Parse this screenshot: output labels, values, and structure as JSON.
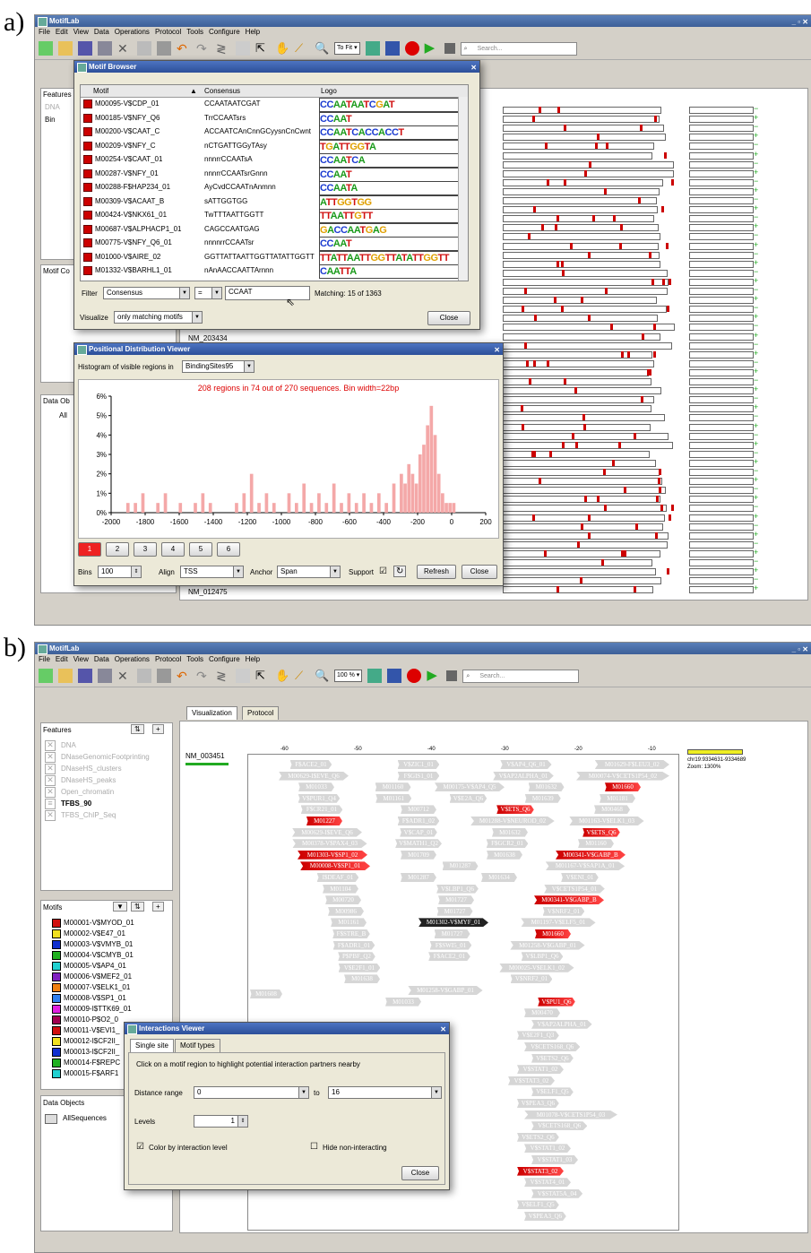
{
  "panel_a": {
    "letter": "a)",
    "app_title": "MotifLab",
    "menus": [
      "File",
      "Edit",
      "View",
      "Data",
      "Operations",
      "Protocol",
      "Tools",
      "Configure",
      "Help"
    ],
    "zoom": "To Fit",
    "search_placeholder": "Search...",
    "features_label": "Features",
    "features_items": [
      "DNA",
      "Bin"
    ],
    "motif_col_label": "Motif Co",
    "data_obj_label": "Data Ob",
    "data_obj_item": "All",
    "seq_labels": [
      "NM_203434",
      "NM_012475"
    ],
    "motif_browser": {
      "title": "Motif Browser",
      "columns": [
        "Motif",
        "Consensus",
        "Logo"
      ],
      "rows": [
        {
          "id": "M00095-V$CDP_01",
          "cons": "CCAATAATCGAT",
          "logo": "CCAATAATCGAT"
        },
        {
          "id": "M00185-V$NFY_Q6",
          "cons": "TrrCCAATsrs",
          "logo": "CCAAT"
        },
        {
          "id": "M00200-V$CAAT_C",
          "cons": "ACCAATCAnCnnGCyysnCnCwnt",
          "logo": "CCAATCACCACCT"
        },
        {
          "id": "M00209-V$NFY_C",
          "cons": "nCTGATTGGyTAsy",
          "logo": "TGATTGGTA"
        },
        {
          "id": "M00254-V$CAAT_01",
          "cons": "nnnrrCCAATsA",
          "logo": "CCAATCA"
        },
        {
          "id": "M00287-V$NFY_01",
          "cons": "nnnrrCCAATsrGnnn",
          "logo": "CCAAT"
        },
        {
          "id": "M00288-F$HAP234_01",
          "cons": "AyCvdCCAATnAnmnn",
          "logo": "CCAATA"
        },
        {
          "id": "M00309-V$ACAAT_B",
          "cons": "sATTGGTGG",
          "logo": "ATTGGTGG"
        },
        {
          "id": "M00424-V$NKX61_01",
          "cons": "TwTTTAATTGGTT",
          "logo": "TTAATTGTT"
        },
        {
          "id": "M00687-V$ALPHACP1_01",
          "cons": "CAGCCAATGAG",
          "logo": "GACCAATGAG"
        },
        {
          "id": "M00775-V$NFY_Q6_01",
          "cons": "nnnnrrCCAATsr",
          "logo": "CCAAT"
        },
        {
          "id": "M01000-V$AIRE_02",
          "cons": "GGTTATTAATTGGTTATATTGGTT",
          "logo": "TTATTAATTGGTTATATTGGTT"
        },
        {
          "id": "M01332-V$BARHL1_01",
          "cons": "nAnAACCAATTArnnn",
          "logo": "CAATTA"
        }
      ],
      "filter_label": "Filter",
      "filter_field": "Consensus",
      "filter_op": "=",
      "filter_value": "CCAAT",
      "matching": "Matching: 15 of 1363",
      "visualize_label": "Visualize",
      "visualize_value": "only matching motifs",
      "close": "Close"
    },
    "pdv": {
      "title": "Positional Distribution Viewer",
      "histogram_label": "Histogram of visible regions in",
      "histogram_track": "BindingSites95",
      "close": "Close",
      "refresh": "Refresh",
      "pages": [
        "1",
        "2",
        "3",
        "4",
        "5",
        "6"
      ],
      "bins_label": "Bins",
      "bins_value": "100",
      "align_label": "Align",
      "align_value": "TSS",
      "anchor_label": "Anchor",
      "anchor_value": "Span",
      "support_label": "Support"
    }
  },
  "chart_data": {
    "type": "bar",
    "title": "208 regions in 74 out of 270 sequences.  Bin width=22bp",
    "xlabel": "",
    "ylabel": "",
    "xlim": [
      -2000,
      200
    ],
    "ylim": [
      0,
      6
    ],
    "xticks": [
      -2000,
      -1800,
      -1600,
      -1400,
      -1200,
      -1000,
      -800,
      -600,
      -400,
      -200,
      0,
      200
    ],
    "yticks": [
      "0%",
      "1%",
      "2%",
      "3%",
      "4%",
      "5%",
      "6%"
    ],
    "bin_width": 22,
    "x": [
      -1900,
      -1856,
      -1812,
      -1724,
      -1680,
      -1592,
      -1504,
      -1460,
      -1416,
      -1262,
      -1218,
      -1174,
      -1130,
      -1086,
      -1042,
      -954,
      -910,
      -866,
      -822,
      -778,
      -734,
      -690,
      -646,
      -602,
      -558,
      -514,
      -470,
      -426,
      -382,
      -338,
      -294,
      -272,
      -250,
      -228,
      -206,
      -184,
      -162,
      -140,
      -118,
      -96,
      -74,
      -52,
      -30,
      -8,
      14
    ],
    "values": [
      0.5,
      0.5,
      1.0,
      0.5,
      1.0,
      0.5,
      0.5,
      1.0,
      0.5,
      0.5,
      1.0,
      2.0,
      0.5,
      1.0,
      0.5,
      1.0,
      0.5,
      1.5,
      0.5,
      1.0,
      0.5,
      1.5,
      0.5,
      1.0,
      0.5,
      1.0,
      0.5,
      1.0,
      0.5,
      1.5,
      2.0,
      1.5,
      2.5,
      2.0,
      1.5,
      3.0,
      3.5,
      4.5,
      5.5,
      4.0,
      2.0,
      1.0,
      0.5,
      0.5,
      0.5
    ]
  },
  "panel_b": {
    "letter": "b)",
    "app_title": "MotifLab",
    "menus": [
      "File",
      "Edit",
      "View",
      "Data",
      "Operations",
      "Protocol",
      "Tools",
      "Configure",
      "Help"
    ],
    "zoom": "100 %",
    "search_placeholder": "Search...",
    "tabs": [
      "Visualization",
      "Protocol"
    ],
    "features_label": "Features",
    "features": [
      "DNA",
      "DNaseGenomicFootprinting",
      "DNaseHS_clusters",
      "DNaseHS_peaks",
      "Open_chromatin",
      "TFBS_90",
      "TFBS_ChIP_Seq"
    ],
    "motifs_label": "Motifs",
    "motifs": [
      {
        "name": "M00001-V$MYOD_01",
        "color": "#d01010"
      },
      {
        "name": "M00002-V$E47_01",
        "color": "#f0e020"
      },
      {
        "name": "M00003-V$VMYB_01",
        "color": "#1030d0"
      },
      {
        "name": "M00004-V$CMYB_01",
        "color": "#20b020"
      },
      {
        "name": "M00005-V$AP4_01",
        "color": "#20d0d0"
      },
      {
        "name": "M00006-V$MEF2_01",
        "color": "#8020c0"
      },
      {
        "name": "M00007-V$ELK1_01",
        "color": "#f08010"
      },
      {
        "name": "M00008-V$SP1_01",
        "color": "#3080f0"
      },
      {
        "name": "M00009-I$TTK69_01",
        "color": "#e020e0"
      },
      {
        "name": "M00010-P$O2_0",
        "color": "#a00050"
      },
      {
        "name": "M00011-V$EVI1_",
        "color": "#d01010"
      },
      {
        "name": "M00012-I$CF2II_",
        "color": "#f0e020"
      },
      {
        "name": "M00013-I$CF2II_",
        "color": "#1030d0"
      },
      {
        "name": "M00014-F$REPC",
        "color": "#20b020"
      },
      {
        "name": "M00015-F$ARF1",
        "color": "#20d0d0"
      }
    ],
    "data_objects_label": "Data Objects",
    "data_objects_item": "AllSequences",
    "sequence_name": "NM_003451",
    "ruler": [
      "-60",
      "-50",
      "-40",
      "-30",
      "-20",
      "-10"
    ],
    "region_info": "chr19:9334631-9334689",
    "zoom_info": "Zoom: 1300%",
    "regions": [
      [
        "F$ACE2_01",
        "V$ZIC1_01",
        "V$AP4_Q6_01",
        "M01629-F$LEU3_02"
      ],
      [
        "M00629-I$EVE_Q6",
        "F$GIS1_01",
        "V$AP2ALPHA_01",
        "M00074-V$CETS1P54_02"
      ],
      [
        "M01033",
        "M01160",
        "M00175-V$AP4_Q5",
        "M01632",
        "M01660"
      ],
      [
        "V$PUR1_Q4",
        "M01161",
        "V$E2A_Q6",
        "M01639",
        "M01181"
      ],
      [
        "F$CR21_01",
        "M00712",
        "V$ETS_Q6",
        "M00468"
      ],
      [
        "M01227",
        "F$ADR1_02",
        "M01288-V$NEUROD_02",
        "M01163-V$ELK1_03"
      ],
      [
        "M00629-I$EVE_Q6",
        "V$CAP_01",
        "M01632",
        "V$ETS_Q6"
      ],
      [
        "M00378-V$PAX4_03",
        "V$MATH1_Q2",
        "F$GCR2_01",
        "M01160"
      ],
      [
        "M01303-V$SP1_02",
        "M01709",
        "M01638",
        "M00341-V$GABP_B"
      ],
      [
        "M00008-V$SP1_01",
        "M01287",
        "M01167-V$SAP1A_01"
      ],
      [
        "I$DEAF_01",
        "M01287",
        "M01634",
        "V$ENI_01"
      ],
      [
        "M01104",
        "V$LBP1_Q6",
        "V$CETS1P54_01"
      ],
      [
        "M00720",
        "M01727",
        "M00341-V$GABP_B"
      ],
      [
        "M00986",
        "M01727",
        "V$NRF2_01"
      ],
      [
        "M01161",
        "M01302-V$MYF_01",
        "M01197-V$ELF5_01"
      ],
      [
        "F$STRE_B",
        "M01727",
        "M01660"
      ],
      [
        "F$ADR1_01",
        "F$SWI5_01",
        "M01258-V$GABP_01"
      ],
      [
        "P$PBF_Q2",
        "F$ACE2_01",
        "V$LBP1_Q6"
      ],
      [
        "V$E2F1_01",
        "M00025-V$ELK1_02"
      ],
      [
        "M01638",
        "V$NRF2_01"
      ],
      [
        "M01258-V$GABP_01"
      ],
      [
        "M01033",
        "V$PU1_Q6"
      ],
      [
        "M00470"
      ],
      [
        "V$AP2ALPHA_01"
      ],
      [
        "V$E2F1_Q3"
      ],
      [
        "V$CETS168_Q6"
      ],
      [
        "V$ETS2_Q6"
      ],
      [
        "V$STAT1_02"
      ],
      [
        "V$STAT3_02"
      ],
      [
        "V$ELF1_Q5"
      ],
      [
        "V$PEA3_Q6"
      ],
      [
        "M01078-V$CETS1P54_03"
      ],
      [
        "V$CETS168_Q6"
      ],
      [
        "V$ETS2_Q6"
      ],
      [
        "V$STAT1_02"
      ],
      [
        "V$STAT1_03"
      ],
      [
        "V$STAT3_02"
      ],
      [
        "V$STAT4_01"
      ],
      [
        "V$STAT5A_04"
      ],
      [
        "V$ELF1_Q5"
      ],
      [
        "V$PEA3_Q6"
      ]
    ],
    "left_region": "M01608",
    "interactions": {
      "title": "Interactions Viewer",
      "tabs": [
        "Single site",
        "Motif types"
      ],
      "instruction": "Click on a motif region to highlight potential interaction partners nearby",
      "distance_label": "Distance range",
      "distance_from": "0",
      "to_label": "to",
      "distance_to": "16",
      "levels_label": "Levels",
      "levels_value": "1",
      "color_label": "Color by interaction level",
      "hide_label": "Hide non-interacting",
      "close": "Close"
    }
  }
}
